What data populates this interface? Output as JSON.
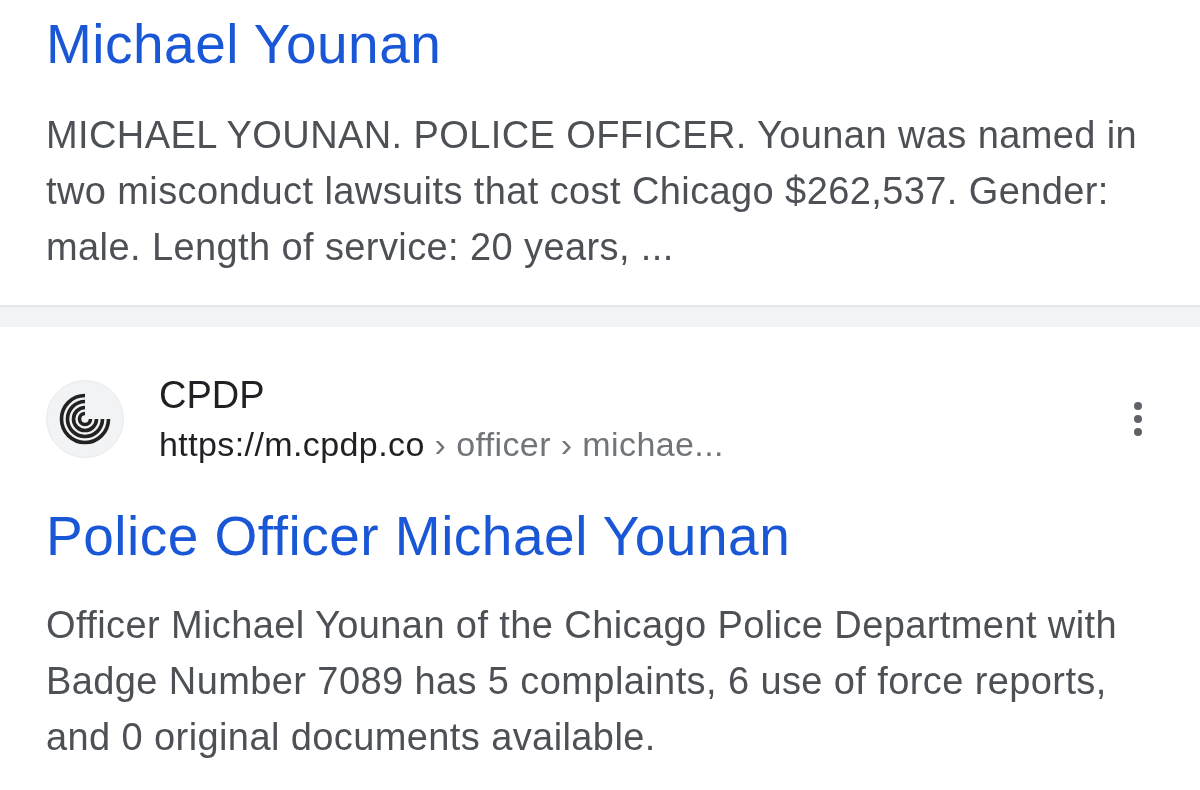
{
  "results": [
    {
      "title": "Michael Younan",
      "snippet": "MICHAEL YOUNAN. POLICE OFFICER. Younan was named in two misconduct lawsuits that cost Chicago $262,537. Gender: male. Length of service: 20 years, ..."
    },
    {
      "site_name": "CPDP",
      "url": "https://m.cpdp.co",
      "url_path": "› officer › michae...",
      "title": "Police Officer Michael Younan",
      "snippet": "Officer Michael Younan of the Chicago Police Department with Badge Number 7089 has 5 complaints, 6 use of force reports, and 0 original documents available."
    }
  ]
}
